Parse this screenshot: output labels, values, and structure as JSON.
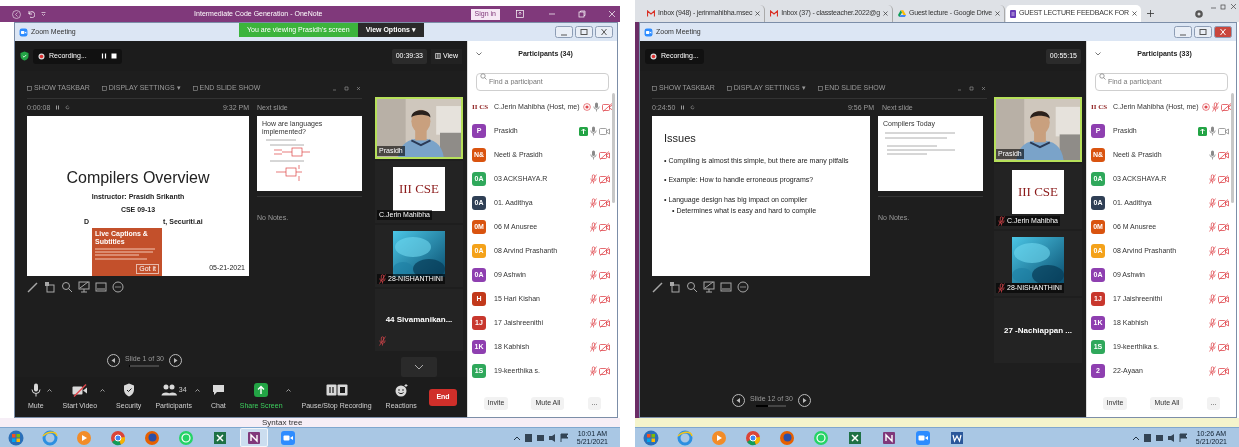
{
  "screens": [
    {
      "kind": "onenote",
      "app_bar": {
        "title": "Intermediate Code Generation - OneNote",
        "sign_in": "Sign in"
      },
      "window_title": "Zoom Meeting",
      "close_active": false,
      "share_banner": {
        "text": "You are viewing Prasidh's screen",
        "options": "View Options ▾"
      },
      "security_badge": true,
      "recording": {
        "label": "Recording...",
        "controls": true
      },
      "timer": "00:39:33",
      "view": "View",
      "presenter": {
        "toolbar": [
          "SHOW TASKBAR",
          "DISPLAY SETTINGS ▾",
          "END SLIDE SHOW"
        ],
        "elapsed": "0:00:08",
        "clock": "9:32 PM",
        "next_label": "Next slide",
        "slide": {
          "kind": "title",
          "title": "Compilers Overview",
          "lines": [
            "Instructor: Prasidh Srikanth",
            "CSE 09-13"
          ],
          "partial_line": [
            "D",
            "t, Securiti.ai"
          ],
          "date": "05-21-2021",
          "popup": {
            "title": "Live Captions & Subtitles",
            "button": "Got it"
          }
        },
        "next_slide": {
          "title": "How are languages implemented?"
        },
        "notes": "No Notes.",
        "counter": "Slide 1 of 30",
        "progress": {
          "level": 0.03
        }
      },
      "tiles": [
        {
          "kind": "video",
          "name": "Prasidh",
          "muted": false,
          "active": true
        },
        {
          "image_text": "III CSE",
          "name": "C.Jerin Mahibha",
          "muted": false,
          "active": false
        },
        {
          "kind": "picture",
          "name": "28-NISHANTHINI",
          "muted": true,
          "active": false
        },
        {
          "kind": "name",
          "name": "44 Sivamanikan...",
          "muted": true,
          "active": false
        }
      ],
      "tiles_scroll_down": true,
      "participants": {
        "title": "Participants (34)",
        "search_placeholder": "Find a participant",
        "buttons": [
          "Invite",
          "Mute All",
          "..."
        ],
        "list": [
          {
            "kind": "logo",
            "initials": "II CS",
            "name": "C.Jerin Mahibha (Host, me)",
            "sharing": false,
            "recording": true,
            "muted": false,
            "video_off": true
          },
          {
            "kind": "initials",
            "initials": "P",
            "color": "#8e3fb0",
            "name": "Prasidh",
            "sharing": true,
            "recording": false,
            "muted": false,
            "video_off": false
          },
          {
            "kind": "initials",
            "initials": "N&",
            "color": "#d9530f",
            "name": "Neeti & Prasidh",
            "sharing": false,
            "recording": false,
            "muted": false,
            "video_off": true
          },
          {
            "kind": "initials",
            "initials": "0A",
            "color": "#2fa85b",
            "name": "03 ACKSHAYA.R",
            "sharing": false,
            "recording": false,
            "muted": true,
            "video_off": true
          },
          {
            "kind": "initials",
            "initials": "0A",
            "color": "#2f3f55",
            "name": "01. Aadithya",
            "sharing": false,
            "recording": false,
            "muted": true,
            "video_off": true
          },
          {
            "kind": "initials",
            "initials": "0M",
            "color": "#d9530f",
            "name": "06 M Anusree",
            "sharing": false,
            "recording": false,
            "muted": true,
            "video_off": true
          },
          {
            "kind": "initials",
            "initials": "0A",
            "color": "#f4a21a",
            "name": "08 Arvind Prashanth",
            "sharing": false,
            "recording": false,
            "muted": true,
            "video_off": true
          },
          {
            "kind": "initials",
            "initials": "0A",
            "color": "#8e3fb0",
            "name": "09 Ashwin",
            "sharing": false,
            "recording": false,
            "muted": true,
            "video_off": true
          },
          {
            "kind": "initials",
            "initials": "H",
            "color": "#c2391b",
            "name": "15 Hari Kishan",
            "sharing": false,
            "recording": false,
            "muted": true,
            "video_off": true
          },
          {
            "kind": "initials",
            "initials": "1J",
            "color": "#c8372d",
            "name": "17 Jaishreenithi",
            "sharing": false,
            "recording": false,
            "muted": true,
            "video_off": true
          },
          {
            "kind": "initials",
            "initials": "1K",
            "color": "#8e3fb0",
            "name": "18 Kabhish",
            "sharing": false,
            "recording": false,
            "muted": true,
            "video_off": true
          },
          {
            "kind": "initials",
            "initials": "1S",
            "color": "#2fa85b",
            "name": "19-keerthika s.",
            "sharing": false,
            "recording": false,
            "muted": true,
            "video_off": true
          }
        ]
      },
      "toolbar": {
        "items": [
          {
            "kind": "mic",
            "label": "Mute",
            "menu": true
          },
          {
            "kind": "video_off",
            "label": "Start Video",
            "menu": true
          },
          {
            "kind": "shield",
            "label": "Security",
            "menu": false
          },
          {
            "kind": "people",
            "label": "Participants",
            "count": "34",
            "menu": true
          },
          {
            "kind": "chat",
            "label": "Chat",
            "menu": false
          },
          {
            "kind": "share",
            "label": "Share Screen",
            "menu": true
          },
          {
            "kind": "record",
            "label": "Pause/Stop Recording",
            "menu": false
          },
          {
            "kind": "smile",
            "label": "Reactions",
            "menu": false
          }
        ],
        "end": "End"
      },
      "desktop_text": "Syntax tree",
      "taskbar": {
        "apps": [
          {
            "kind": "start",
            "selected": false
          },
          {
            "kind": "ie",
            "selected": false
          },
          {
            "kind": "media",
            "selected": false
          },
          {
            "kind": "chrome",
            "selected": false
          },
          {
            "kind": "firefox",
            "selected": false
          },
          {
            "kind": "whatsapp",
            "selected": false
          },
          {
            "kind": "excel",
            "selected": false
          },
          {
            "kind": "onenote",
            "selected": true
          },
          {
            "kind": "zoom",
            "selected": false
          }
        ],
        "time": "10:01 AM",
        "date": "5/21/2021"
      }
    },
    {
      "kind": "chrome",
      "app_bar": {
        "tabs": [
          {
            "kind": "mail",
            "title": "Inbox (948) - jerinmahibha.msec",
            "selected": false
          },
          {
            "kind": "mail",
            "title": "Inbox (37) - classteacher.2022@g",
            "selected": false
          },
          {
            "kind": "drive",
            "title": "Guest lecture - Google Drive",
            "selected": false
          },
          {
            "kind": "form",
            "title": "GUEST LECTURE FEEDBACK FOR",
            "selected": true
          }
        ]
      },
      "window_title": "Zoom Meeting",
      "close_active": true,
      "security_badge": false,
      "recording": {
        "label": "Recording...",
        "controls": false
      },
      "timer": "00:55:15",
      "presenter": {
        "toolbar": [
          "SHOW TASKBAR",
          "DISPLAY SETTINGS ▾",
          "END SLIDE SHOW"
        ],
        "elapsed": "0:24:50",
        "clock": "9:56 PM",
        "next_label": "Next slide",
        "slide": {
          "kind": "bullets",
          "title": "Issues",
          "bullets": [
            {
              "text": "• Compiling is almost this simple, but there are many pitfalls"
            },
            {
              "text": "• Example: How to handle erroneous programs?"
            },
            {
              "text": "• Language design has big impact on compiler",
              "children": [
                {
                  "text": "• Determines what is easy and hard to compile"
                }
              ]
            }
          ]
        },
        "next_slide": {
          "title": "Compilers Today"
        },
        "notes": "No Notes.",
        "counter": "Slide 12 of 30",
        "progress": {
          "level": 0.4
        }
      },
      "tiles": [
        {
          "kind": "video",
          "name": "Prasidh",
          "muted": false,
          "active": true
        },
        {
          "image_text": "III CSE",
          "name": "C.Jerin Mahibha",
          "muted": true,
          "active": false
        },
        {
          "kind": "picture",
          "name": "28-NISHANTHINI",
          "muted": true,
          "active": false
        },
        {
          "kind": "name",
          "name": "27 -Nachiappan ...",
          "muted": false,
          "active": false
        }
      ],
      "tiles_scroll_down": false,
      "participants": {
        "title": "Participants (33)",
        "search_placeholder": "Find a participant",
        "buttons": [
          "Invite",
          "Mute All",
          "..."
        ],
        "list": [
          {
            "kind": "logo",
            "initials": "II CS",
            "name": "C.Jerin Mahibha (Host, me)",
            "sharing": false,
            "recording": true,
            "muted": true,
            "video_off": true
          },
          {
            "kind": "initials",
            "initials": "P",
            "color": "#8e3fb0",
            "name": "Prasidh",
            "sharing": true,
            "recording": false,
            "muted": false,
            "video_off": false
          },
          {
            "kind": "initials",
            "initials": "N&",
            "color": "#d9530f",
            "name": "Neeti & Prasidh",
            "sharing": false,
            "recording": false,
            "muted": false,
            "video_off": true
          },
          {
            "kind": "initials",
            "initials": "0A",
            "color": "#2fa85b",
            "name": "03 ACKSHAYA.R",
            "sharing": false,
            "recording": false,
            "muted": true,
            "video_off": true
          },
          {
            "kind": "initials",
            "initials": "0A",
            "color": "#2f3f55",
            "name": "01. Aadithya",
            "sharing": false,
            "recording": false,
            "muted": true,
            "video_off": true
          },
          {
            "kind": "initials",
            "initials": "0M",
            "color": "#d9530f",
            "name": "06 M Anusree",
            "sharing": false,
            "recording": false,
            "muted": true,
            "video_off": true
          },
          {
            "kind": "initials",
            "initials": "0A",
            "color": "#f4a21a",
            "name": "08 Arvind Prashanth",
            "sharing": false,
            "recording": false,
            "muted": true,
            "video_off": true
          },
          {
            "kind": "initials",
            "initials": "0A",
            "color": "#8e3fb0",
            "name": "09 Ashwin",
            "sharing": false,
            "recording": false,
            "muted": true,
            "video_off": true
          },
          {
            "kind": "initials",
            "initials": "1J",
            "color": "#c8372d",
            "name": "17 Jaishreenithi",
            "sharing": false,
            "recording": false,
            "muted": true,
            "video_off": true
          },
          {
            "kind": "initials",
            "initials": "1K",
            "color": "#8e3fb0",
            "name": "18 Kabhish",
            "sharing": false,
            "recording": false,
            "muted": true,
            "video_off": true
          },
          {
            "kind": "initials",
            "initials": "1S",
            "color": "#2fa85b",
            "name": "19-keerthika s.",
            "sharing": false,
            "recording": false,
            "muted": true,
            "video_off": true
          },
          {
            "kind": "initials",
            "initials": "2",
            "color": "#8e3fb0",
            "name": "22-Ayaan",
            "sharing": false,
            "recording": false,
            "muted": true,
            "video_off": true
          }
        ]
      },
      "taskbar": {
        "apps": [
          {
            "kind": "start",
            "selected": false
          },
          {
            "kind": "ie",
            "selected": false
          },
          {
            "kind": "media",
            "selected": false
          },
          {
            "kind": "chrome",
            "selected": false
          },
          {
            "kind": "firefox",
            "selected": false
          },
          {
            "kind": "whatsapp",
            "selected": false
          },
          {
            "kind": "excel",
            "selected": false
          },
          {
            "kind": "onenote",
            "selected": false
          },
          {
            "kind": "zoom",
            "selected": false
          },
          {
            "kind": "word",
            "selected": false
          }
        ],
        "time": "10:26 AM",
        "date": "5/21/2021"
      }
    }
  ]
}
